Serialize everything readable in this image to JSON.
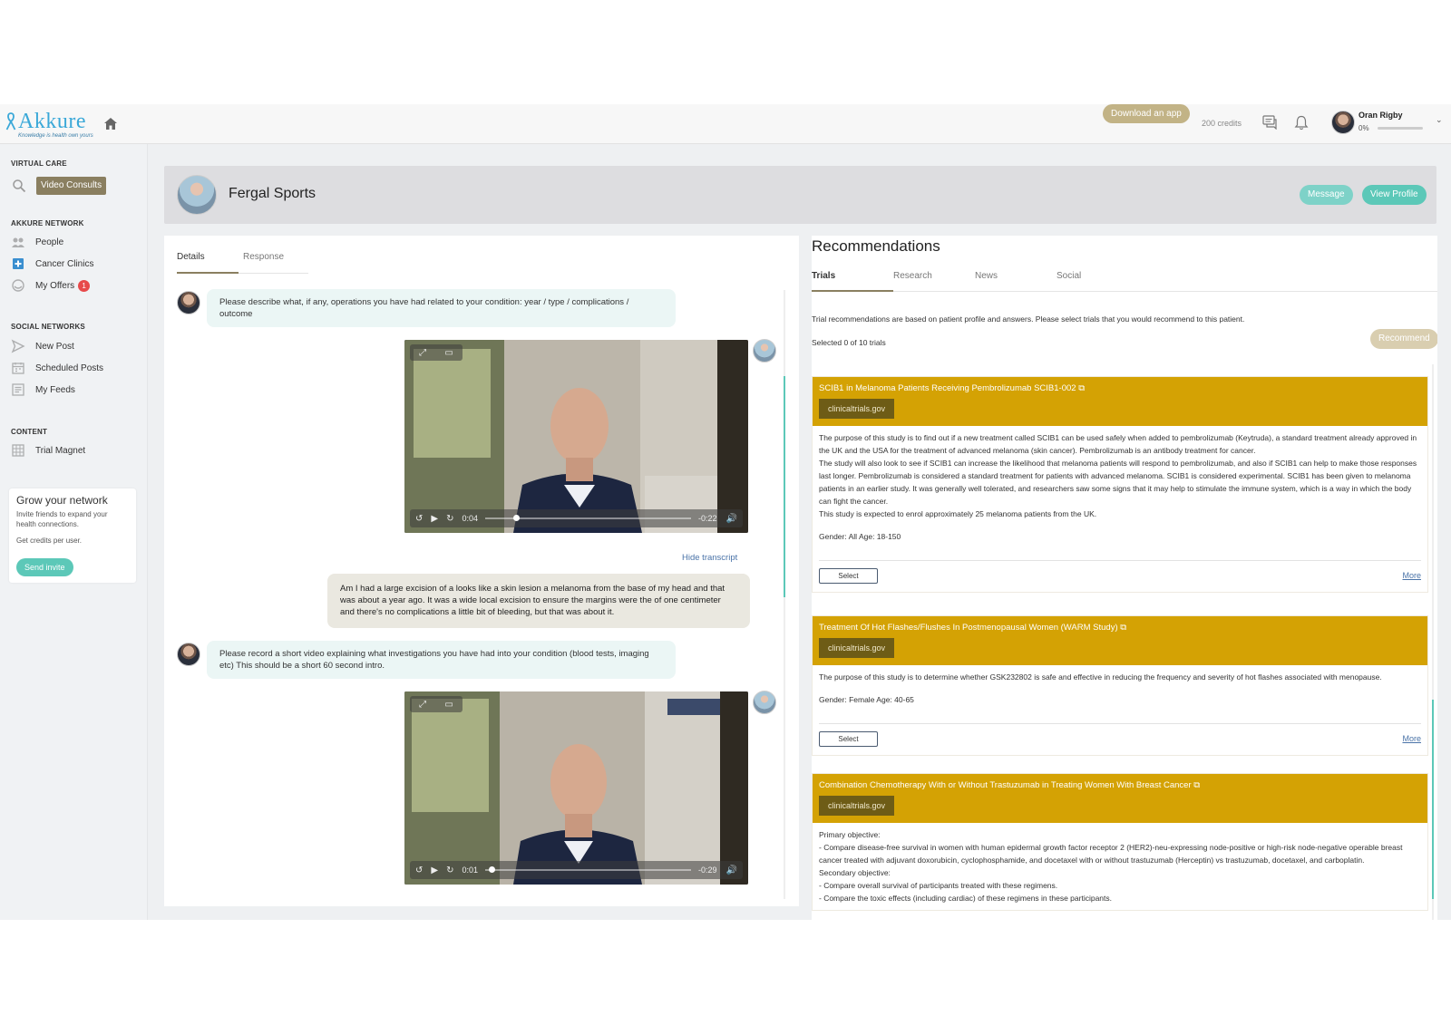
{
  "header": {
    "brand": "Akkure",
    "tagline": "Knowledge is health own yours",
    "download_label": "Download an app",
    "credits": "200 credits",
    "user_name": "Oran Rigby",
    "user_progress_text": "0%",
    "user_progress": 0
  },
  "sidebar": {
    "virtual_care_title": "VIRTUAL CARE",
    "video_consults": "Video Consults",
    "network_title": "AKKURE NETWORK",
    "people": "People",
    "cancer_clinics": "Cancer Clinics",
    "my_offers": "My Offers",
    "offers_badge": "1",
    "social_title": "SOCIAL NETWORKS",
    "new_post": "New Post",
    "scheduled_posts": "Scheduled Posts",
    "my_feeds": "My Feeds",
    "content_title": "CONTENT",
    "trial_magnet": "Trial Magnet",
    "grow": {
      "title": "Grow your network",
      "subtitle": "Invite friends to expand your health connections.",
      "credits_note": "Get credits per user.",
      "button": "Send invite"
    }
  },
  "patient": {
    "name": "Fergal Sports",
    "message_label": "Message",
    "profile_label": "View Profile"
  },
  "consult": {
    "tabs": [
      "Details",
      "Response"
    ],
    "question1": "Please describe what, if any, operations you have had related to your condition: year / type / complications / outcome",
    "video1": {
      "elapsed": "0:04",
      "remaining": "-0:22",
      "progress": 0.15
    },
    "hide_transcript": "Hide transcript",
    "answer1": "Am I had a large excision of a looks like a skin lesion a melanoma from the base of my head and that was about a year ago. It was a wide local excision to ensure the margins were the of one centimeter and there's no complications a little bit of bleeding, but that was about it.",
    "question2": "Please record a short video explaining what investigations you have had into your condition (blood tests, imaging etc) This should be a short 60 second intro.",
    "video2": {
      "elapsed": "0:01",
      "remaining": "-0:29",
      "progress": 0.03
    }
  },
  "recommendations": {
    "title": "Recommendations",
    "tabs": [
      "Trials",
      "Research",
      "News",
      "Social"
    ],
    "intro": "Trial recommendations are based on patient profile and answers. Please select trials that you would recommend to this patient.",
    "selected": "Selected 0 of 10 trials",
    "recommend_label": "Recommend",
    "select_label": "Select",
    "more_label": "More",
    "trials": [
      {
        "title": "SCIB1 in Melanoma Patients Receiving Pembrolizumab SCIB1-002",
        "source": "clinicaltrials.gov",
        "description": [
          "The purpose of this study is to find out if a new treatment called SCIB1 can be used safely when added to pembrolizumab (Keytruda), a standard treatment already approved in the UK and the USA for the treatment of advanced melanoma (skin cancer). Pembrolizumab is an antibody treatment for cancer.",
          "The study will also look to see if SCIB1 can increase the likelihood that melanoma patients will respond to pembrolizumab, and also if SCIB1 can help to make those responses last longer. Pembrolizumab is considered a standard treatment for patients with advanced melanoma. SCIB1 is considered experimental. SCIB1 has been given to melanoma patients in an earlier study. It was generally well tolerated, and researchers saw some signs that it may help to stimulate the immune system, which is a way in which the body can fight the cancer.",
          "This study is expected to enrol approximately 25 melanoma patients from the UK."
        ],
        "meta": "Gender: All   Age: 18-150"
      },
      {
        "title": "Treatment Of Hot Flashes/Flushes In Postmenopausal Women (WARM Study)",
        "source": "clinicaltrials.gov",
        "description": [
          "The purpose of this study is to determine whether GSK232802 is safe and effective in reducing the frequency and severity of hot flashes associated with menopause."
        ],
        "meta": "Gender: Female   Age: 40-65"
      },
      {
        "title": "Combination Chemotherapy With or Without Trastuzumab in Treating Women With Breast Cancer",
        "source": "clinicaltrials.gov",
        "description": [
          "Primary objective:",
          "- Compare disease-free survival in women with human epidermal growth factor receptor 2 (HER2)-neu-expressing node-positive or high-risk node-negative operable breast cancer treated with adjuvant doxorubicin, cyclophosphamide, and docetaxel with or without trastuzumab (Herceptin) vs trastuzumab, docetaxel, and carboplatin.",
          "Secondary objective:",
          "- Compare overall survival of participants treated with these regimens.",
          "- Compare the toxic effects (including cardiac) of these regimens in these participants."
        ]
      }
    ]
  },
  "colors": {
    "teal": "#5cc8b8",
    "gold": "#d4a204",
    "brand_blue": "#3aa8d8",
    "olive": "#8a7f60"
  }
}
